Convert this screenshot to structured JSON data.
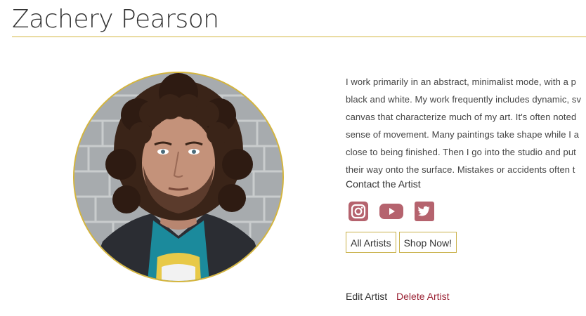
{
  "artist": {
    "name": "Zachery Pearson"
  },
  "bio": {
    "lines": [
      "I work primarily in an abstract, minimalist mode, with a p",
      "black and white. My work frequently includes dynamic, sv",
      "canvas that characterize much of my art. It's often noted",
      "sense of movement. Many paintings take shape while I a",
      "close to being finished. Then I go into the studio and put",
      "their way onto the surface. Mistakes or accidents often t"
    ]
  },
  "contact": {
    "label": "Contact the Artist"
  },
  "social": {
    "color": "#b5636e",
    "icons": [
      "instagram-icon",
      "youtube-icon",
      "twitter-icon"
    ]
  },
  "buttons": {
    "all_artists": "All Artists",
    "shop_now": "Shop Now!"
  },
  "admin": {
    "edit": "Edit Artist",
    "delete": "Delete Artist"
  },
  "colors": {
    "accent_gold": "#d4b53e",
    "delete_red": "#9b2335"
  }
}
